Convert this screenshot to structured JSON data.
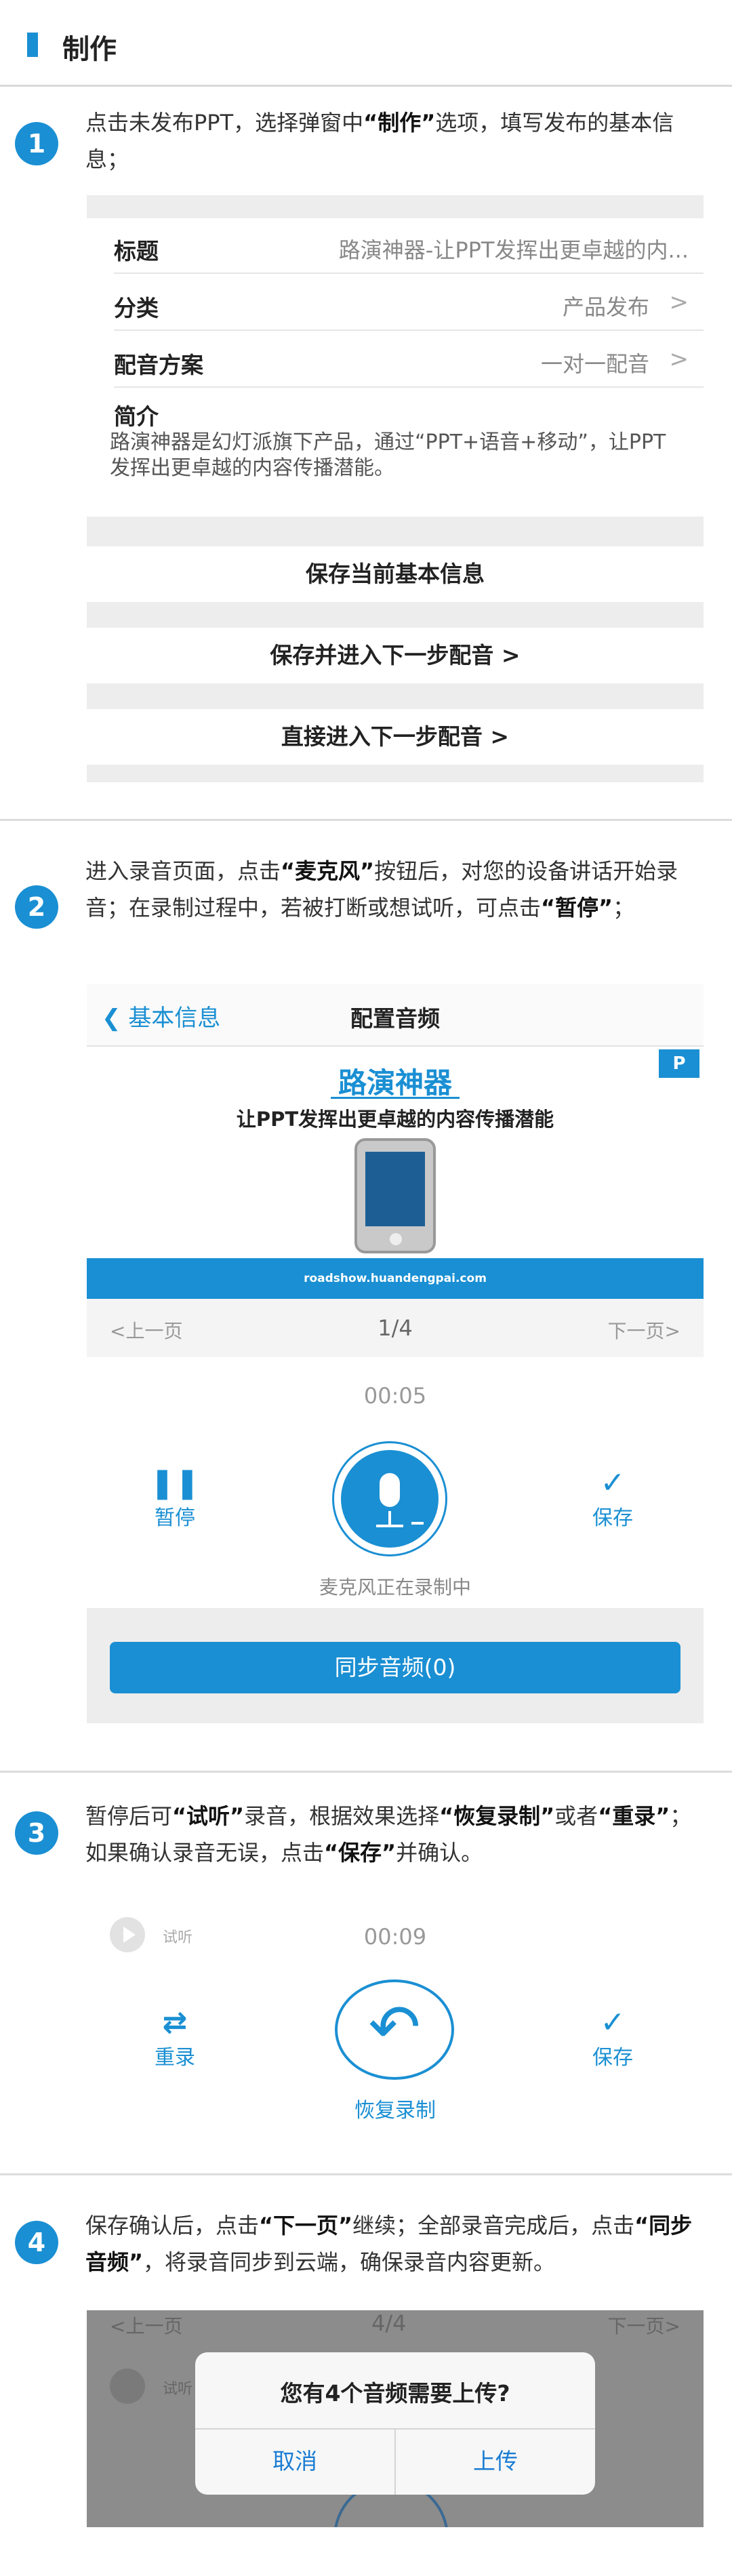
{
  "header": {
    "title": "制作"
  },
  "steps": {
    "s1": {
      "num": "1",
      "t1": "点击未发布PPT，选择弹窗中",
      "b1": "“制作”",
      "t2": "选项，填写发布的基本信息；"
    },
    "s2": {
      "num": "2",
      "t1": "进入录音页面，点击",
      "b1": "“麦克风”",
      "t2": "按钮后，对您的设备讲话开始录音；在录制过程中，若被打断或想试听，可点击",
      "b2": "“暂停”",
      "t3": "；"
    },
    "s3": {
      "num": "3",
      "t1": "暂停后可",
      "b1": "“试听”",
      "t2": "录音，根据效果选择",
      "b2": "“恢复录制”",
      "t3": "或者",
      "b3": "“重录”",
      "t4": "；如果确认录音无误，点击",
      "b4": "“保存”",
      "t5": "并确认。"
    },
    "s4": {
      "num": "4",
      "t1": "保存确认后，点击",
      "b1": "“下一页”",
      "t2": "继续；全部录音完成后，点击",
      "b2": "“同步音频”",
      "t3": "，将录音同步到云端，确保录音内容更新。"
    }
  },
  "form": {
    "title_label": "标题",
    "title_value": "路演神器-让PPT发挥出更卓越的内...",
    "category_label": "分类",
    "category_value": "产品发布",
    "dubbing_label": "配音方案",
    "dubbing_value": "一对一配音",
    "intro_label": "简介",
    "intro_text": "路演神器是幻灯派旗下产品，通过“PPT+语音+移动”，让PPT发挥出更卓越的内容传播潜能。",
    "btn_save_info": "保存当前基本信息",
    "btn_save_next": "保存并进入下一步配音 >",
    "btn_direct_next": "直接进入下一步配音 >",
    "chevron": ">"
  },
  "recorder": {
    "back_label": "基本信息",
    "nav_title": "配置音频",
    "slide_brand": "路演神器",
    "slide_tagline": "让PPT发挥出更卓越的内容传播潜能",
    "slide_url": "roadshow.huandengpai.com",
    "prev": "<上一页",
    "page": "1/4",
    "next": "下一页>",
    "timer": "00:05",
    "pause_label": "暂停",
    "save_label": "保存",
    "status": "麦克风正在录制中",
    "sync_label": "同步音频(0)"
  },
  "step3_ui": {
    "listen_label": "试听",
    "timer": "00:09",
    "rerecord_label": "重录",
    "resume_label": "恢复录制",
    "save_label": "保存"
  },
  "step4_ui": {
    "prev": "<上一页",
    "page": "4/4",
    "next": "下一页>",
    "listen_label": "试听",
    "dialog_msg": "您有4个音频需要上传?",
    "cancel": "取消",
    "upload": "上传"
  },
  "colors": {
    "accent": "#1a8fd3",
    "divider": "#dcdcdc",
    "form_bg": "#ededed"
  }
}
